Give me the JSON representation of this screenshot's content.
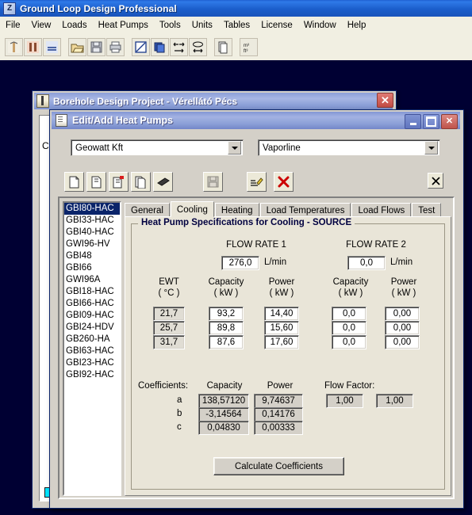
{
  "app": {
    "title": "Ground Loop Design Professional",
    "icon": "app-logo-icon",
    "menu": [
      "File",
      "View",
      "Loads",
      "Heat Pumps",
      "Tools",
      "Units",
      "Tables",
      "License",
      "Window",
      "Help"
    ],
    "toolbar_icons": [
      "borehole-icon",
      "column-icon",
      "horizontal-loop-icon",
      "open-folder-icon",
      "save-icon",
      "print-icon",
      "diagonal-square-icon",
      "copy-pages-icon",
      "flow-left-right-icon",
      "flow-converge-icon",
      "duplicate-page-icon",
      "unit-convert-icon"
    ]
  },
  "borehole_window": {
    "title": "Borehole Design Project - Vérellátó Pécs",
    "icon": "borehole-window-icon",
    "close_label": "✕",
    "hidden_letter": "C"
  },
  "heatpump_window": {
    "title": "Edit/Add Heat Pumps",
    "icon": "heat-pump-window-icon",
    "minimize_label": "",
    "maximize_label": "",
    "close_label": "✕",
    "combos": {
      "manufacturer": "Geowatt Kft",
      "model": "Vaporline"
    },
    "inner_toolbar_icons": [
      "new-document-icon",
      "copy-document-icon",
      "new-with-flag-icon",
      "duplicate-stack-icon",
      "eraser-icon",
      "save-disk-icon",
      "edit-pencil-icon",
      "delete-x-icon",
      "close-x-icon"
    ],
    "list_items": [
      "GBI80-HAC",
      "GBI33-HAC",
      "GBI40-HAC",
      "GWI96-HV",
      "GBI48",
      "GBI66",
      "GWI96A",
      "GBI18-HAC",
      "GBI66-HAC",
      "GBI09-HAC",
      "GBI24-HDV",
      "GB260-HA",
      "GBI63-HAC",
      "GBI23-HAC",
      "GBI92-HAC"
    ],
    "selected_item": "GBI80-HAC",
    "tabs": [
      {
        "label": "General",
        "active": false
      },
      {
        "label": "Cooling",
        "active": true
      },
      {
        "label": "Heating",
        "active": false
      },
      {
        "label": "Load Temperatures",
        "active": false
      },
      {
        "label": "Load Flows",
        "active": false
      },
      {
        "label": "Test",
        "active": false
      }
    ],
    "cooling": {
      "group_title": "Heat Pump Specifications for Cooling - SOURCE",
      "flow_rate_1_label": "FLOW RATE 1",
      "flow_rate_2_label": "FLOW RATE 2",
      "flow_rate_1_value": "276,0",
      "flow_rate_2_value": "0,0",
      "flow_unit": "L/min",
      "col_ewt": "EWT",
      "col_ewt_unit": "( °C )",
      "col_capacity": "Capacity",
      "col_power": "Power",
      "col_unit_kw": "( kW )",
      "rows": [
        {
          "ewt": "21,7",
          "cap1": "93,2",
          "pow1": "14,40",
          "cap2": "0,0",
          "pow2": "0,00"
        },
        {
          "ewt": "25,7",
          "cap1": "89,8",
          "pow1": "15,60",
          "cap2": "0,0",
          "pow2": "0,00"
        },
        {
          "ewt": "31,7",
          "cap1": "87,6",
          "pow1": "17,60",
          "cap2": "0,0",
          "pow2": "0,00"
        }
      ],
      "coefficients_label": "Coefficients:",
      "coeff_capacity_header": "Capacity",
      "coeff_power_header": "Power",
      "coeff_rows": [
        {
          "name": "a",
          "capacity": "138,57120",
          "power": "9,74637"
        },
        {
          "name": "b",
          "capacity": "-3,14564",
          "power": "0,14176"
        },
        {
          "name": "c",
          "capacity": "0,04830",
          "power": "0,00333"
        }
      ],
      "flow_factor_label": "Flow Factor:",
      "flow_factor_1": "1,00",
      "flow_factor_2": "1,00",
      "calculate_button": "Calculate Coefficients"
    }
  },
  "colors": {
    "desktop": "#000033",
    "app_title_blue": "#1b5ecb",
    "dialog_title_blue": "#8b9fd7",
    "face": "#d4d0c8",
    "tabpage": "#e9e5d8",
    "selection": "#0a246a",
    "close_red": "#c24c44",
    "group_title": "#000040"
  }
}
